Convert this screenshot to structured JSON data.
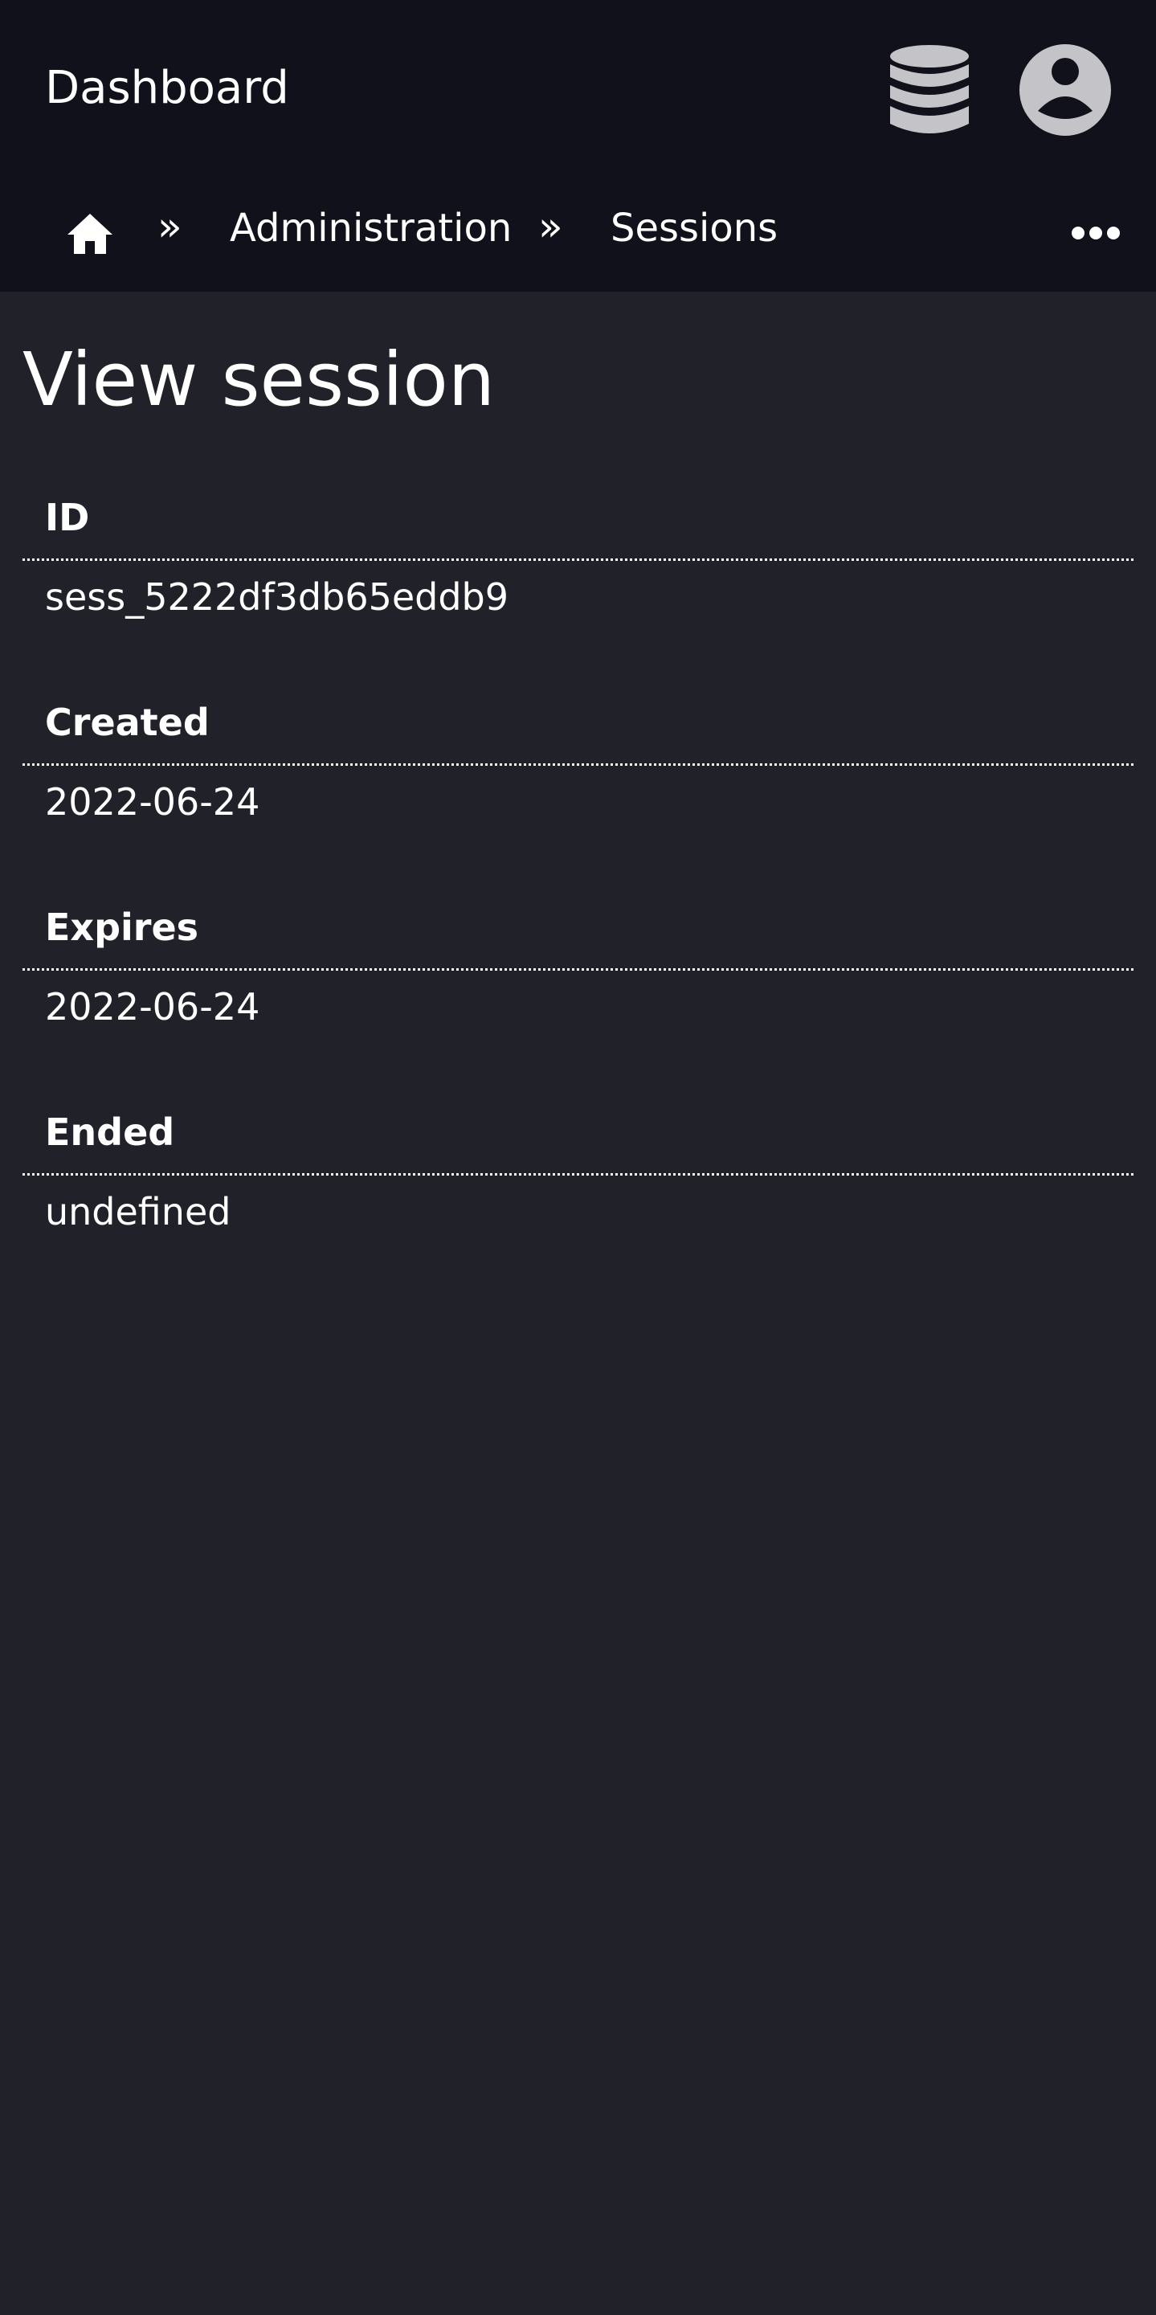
{
  "header": {
    "title": "Dashboard",
    "db_icon": "database-icon",
    "user_icon": "user-circle-icon",
    "colors": {
      "background": "#11111b",
      "icon": "#c4c4c8",
      "text": "#ffffff"
    }
  },
  "breadcrumb": {
    "home_icon": "home-icon",
    "separator": "»",
    "items": [
      {
        "label": "Administration"
      },
      {
        "label": "Sessions"
      }
    ],
    "more_icon": "more-horizontal-icon"
  },
  "page": {
    "title": "View session",
    "background": "#21212a"
  },
  "fields": [
    {
      "label": "ID",
      "value": "sess_5222df3db65eddb9"
    },
    {
      "label": "Created",
      "value": "2022-06-24"
    },
    {
      "label": "Expires",
      "value": "2022-06-24"
    },
    {
      "label": "Ended",
      "value": "undefined"
    }
  ]
}
